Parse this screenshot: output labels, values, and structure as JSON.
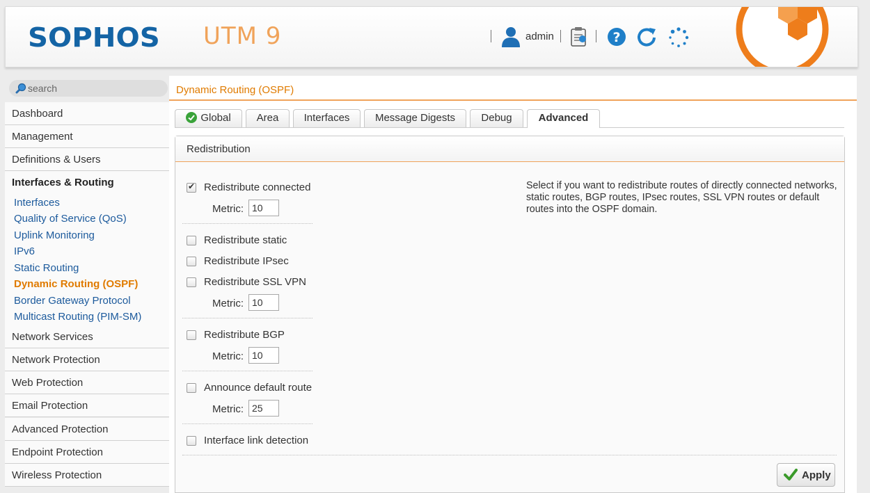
{
  "header": {
    "logo": "SOPHOS",
    "product": "UTM 9",
    "user": "admin",
    "colors": {
      "brand": "#1464a5",
      "accent": "#e07b00",
      "product": "#f0a35a"
    },
    "icons": [
      "user-icon",
      "report-icon",
      "help-icon",
      "reload-icon",
      "activity-icon",
      "orange-emblem-icon"
    ]
  },
  "sidebar": {
    "search_placeholder": "search",
    "sections_top": [
      "Dashboard",
      "Management",
      "Definitions & Users"
    ],
    "active_section": "Interfaces & Routing",
    "subitems": [
      "Interfaces",
      "Quality of Service (QoS)",
      "Uplink Monitoring",
      "IPv6",
      "Static Routing",
      "Dynamic Routing (OSPF)",
      "Border Gateway Protocol",
      "Multicast Routing (PIM-SM)"
    ],
    "current_subitem": "Dynamic Routing (OSPF)",
    "sections_bottom": [
      "Network Services",
      "Network Protection",
      "Web Protection",
      "Email Protection",
      "Advanced Protection",
      "Endpoint Protection",
      "Wireless Protection"
    ]
  },
  "main": {
    "title": "Dynamic Routing (OSPF)",
    "tabs": [
      "Global",
      "Area",
      "Interfaces",
      "Message Digests",
      "Debug",
      "Advanced"
    ],
    "active_tab": "Advanced",
    "panel": {
      "title": "Redistribution",
      "options": [
        {
          "label": "Redistribute connected",
          "checked": true
        },
        {
          "label": "Redistribute static",
          "checked": false
        },
        {
          "label": "Redistribute IPsec",
          "checked": false
        },
        {
          "label": "Redistribute SSL VPN",
          "checked": false
        },
        {
          "label": "Redistribute BGP",
          "checked": false
        },
        {
          "label": "Announce default route",
          "checked": false
        },
        {
          "label": "Interface link detection",
          "checked": false
        }
      ],
      "metric_label": "Metric:",
      "metrics": [
        "10",
        "10",
        "10",
        "25"
      ],
      "help": "Select if you want to redistribute routes of directly connected networks, static routes, BGP routes, IPsec routes, SSL VPN routes or default routes into the OSPF domain.",
      "apply_label": "Apply"
    }
  }
}
